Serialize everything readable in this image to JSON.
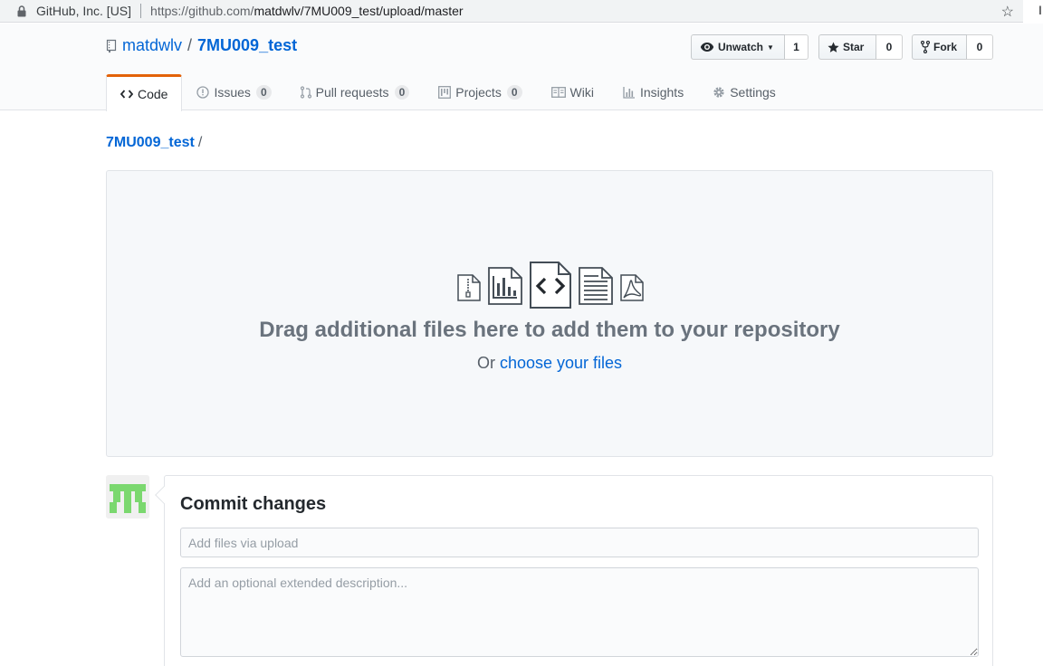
{
  "browser": {
    "site_identity": "GitHub, Inc. [US]",
    "url_prefix": "https://github.com/",
    "url_path": "matdwlv/7MU009_test/upload/master",
    "edge_char": "I"
  },
  "repo": {
    "owner": "matdwlv",
    "separator": "/",
    "name": "7MU009_test"
  },
  "actions": {
    "watch_label": "Unwatch",
    "watch_count": "1",
    "star_label": "Star",
    "star_count": "0",
    "fork_label": "Fork",
    "fork_count": "0"
  },
  "tabs": [
    {
      "label": "Code",
      "icon": "code-icon"
    },
    {
      "label": "Issues",
      "count": "0",
      "icon": "issue-opened-icon"
    },
    {
      "label": "Pull requests",
      "count": "0",
      "icon": "git-pull-request-icon"
    },
    {
      "label": "Projects",
      "count": "0",
      "icon": "project-icon"
    },
    {
      "label": "Wiki",
      "icon": "book-icon"
    },
    {
      "label": "Insights",
      "icon": "graph-icon"
    },
    {
      "label": "Settings",
      "icon": "gear-icon"
    }
  ],
  "breadcrumb": {
    "repo": "7MU009_test",
    "separator": "/"
  },
  "dropzone": {
    "heading": "Drag additional files here to add them to your repository",
    "or_text": "Or",
    "choose_link": "choose your files",
    "icons": [
      "file-zip-icon",
      "file-chart-icon",
      "file-code-icon",
      "file-text-icon",
      "file-pdf-icon"
    ]
  },
  "commit": {
    "heading": "Commit changes",
    "summary_placeholder": "Add files via upload",
    "description_placeholder": "Add an optional extended description..."
  },
  "colors": {
    "link": "#0366d6",
    "selected_tab_border": "#e36209",
    "avatar_green": "#7bd86f"
  }
}
